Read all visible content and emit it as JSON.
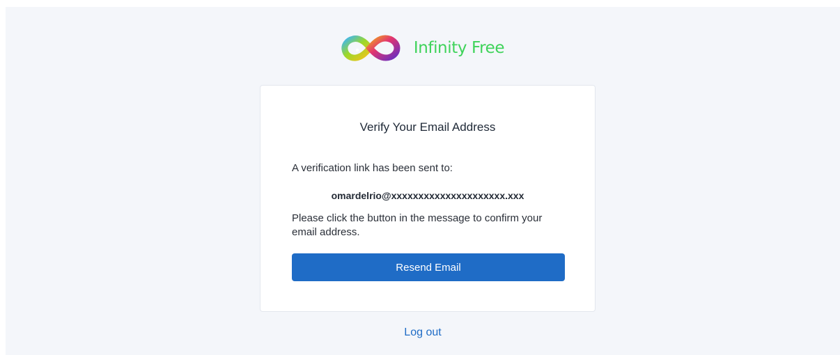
{
  "brand": {
    "name": "Infinity Free"
  },
  "card": {
    "title": "Verify Your Email Address",
    "sent_label": "A verification link has been sent to:",
    "email": "omardelrio@xxxxxxxxxxxxxxxxxxxxx.xxx",
    "instructions": "Please click the button in the message to confirm your email address.",
    "resend_label": "Resend Email"
  },
  "footer": {
    "logout_label": "Log out"
  },
  "colors": {
    "page_background": "#f4f6fa",
    "brand_text": "#3fd35a",
    "primary": "#1f6cc6",
    "card_border": "#e3e7ee"
  },
  "icons": {
    "logo": "infinity-logo-icon"
  }
}
